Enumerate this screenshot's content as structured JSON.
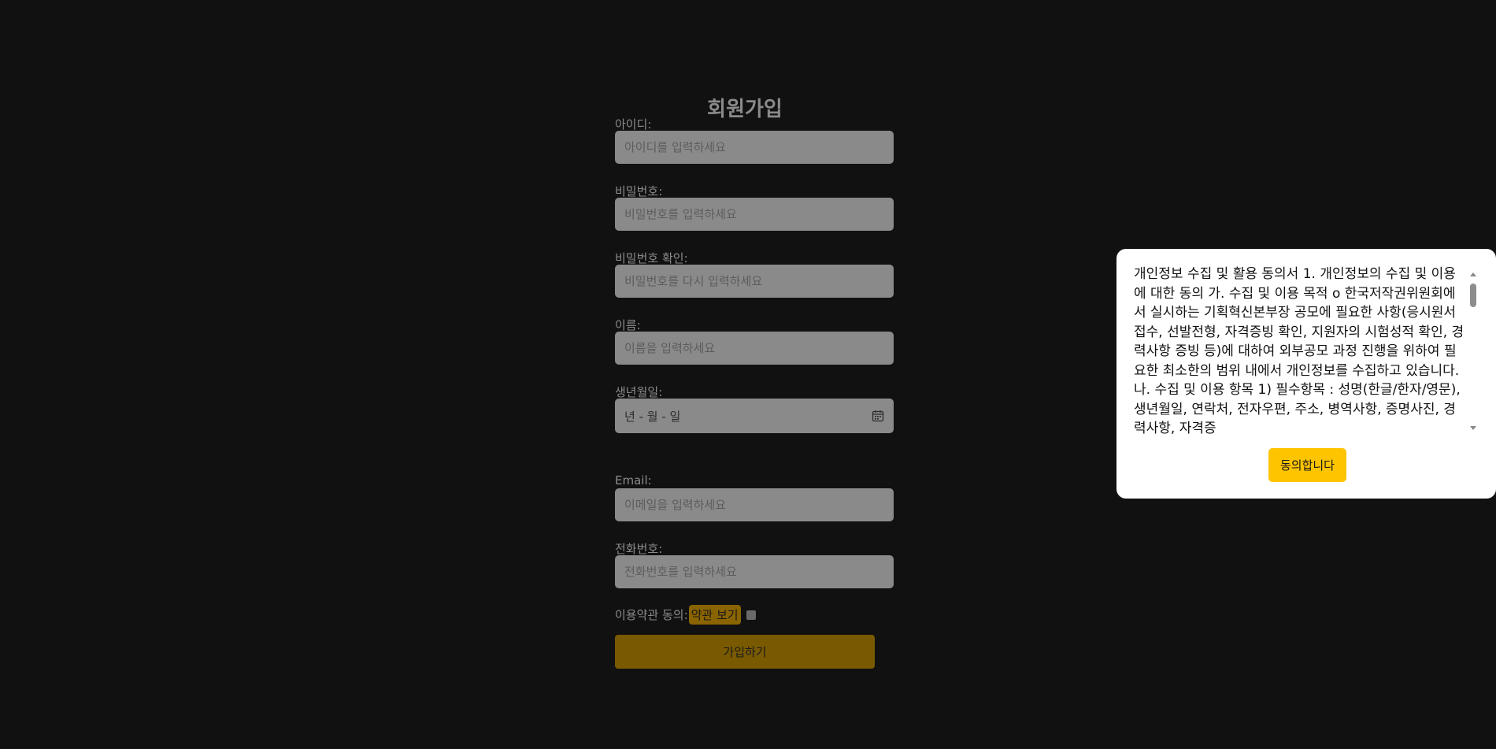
{
  "form": {
    "title": "회원가입",
    "fields": {
      "id": {
        "label": "아이디:",
        "placeholder": "아이디를 입력하세요"
      },
      "password": {
        "label": "비밀번호:",
        "placeholder": "비밀번호를 입력하세요"
      },
      "password_confirm": {
        "label": "비밀번호 확인:",
        "placeholder": "비밀번호를 다시 입력하세요"
      },
      "name": {
        "label": "이름:",
        "placeholder": "이름을 입력하세요"
      },
      "birth": {
        "label": "생년월일:",
        "value": "년 - 월 - 일",
        "icon": "calendar-icon"
      },
      "email": {
        "label": "Email:",
        "placeholder": "이메일을 입력하세요"
      },
      "phone": {
        "label": "전화번호:",
        "placeholder": "전화번호를 입력하세요"
      }
    },
    "terms": {
      "label": "이용약관 동의:",
      "link": "약관 보기",
      "checked": false
    },
    "submit_label": "가입하기"
  },
  "modal": {
    "text": "개인정보 수집 및 활용 동의서 1. 개인정보의 수집 및 이용에 대한 동의 가. 수집 및 이용 목적 o 한국저작권위원회에서 실시하는 기획혁신본부장 공모에 필요한 사항(응시원서 접수, 선발전형, 자격증빙 확인, 지원자의 시험성적 확인, 경력사항 증빙 등)에 대하여 외부공모 과정 진행을 위하여 필요한 최소한의 범위 내에서 개인정보를 수집하고 있습니다. 나. 수집 및 이용 항목 1) 필수항목 : 성명(한글/한자/영문), 생년월일, 연락처, 전자우편, 주소, 병역사항, 증명사진, 경력사항, 자격증",
    "agree_label": "동의합니다"
  },
  "colors": {
    "background": "#111111",
    "input_bg": "#8a8a8a",
    "accent": "#ffc400",
    "accent_dim": "#7a5a00"
  }
}
